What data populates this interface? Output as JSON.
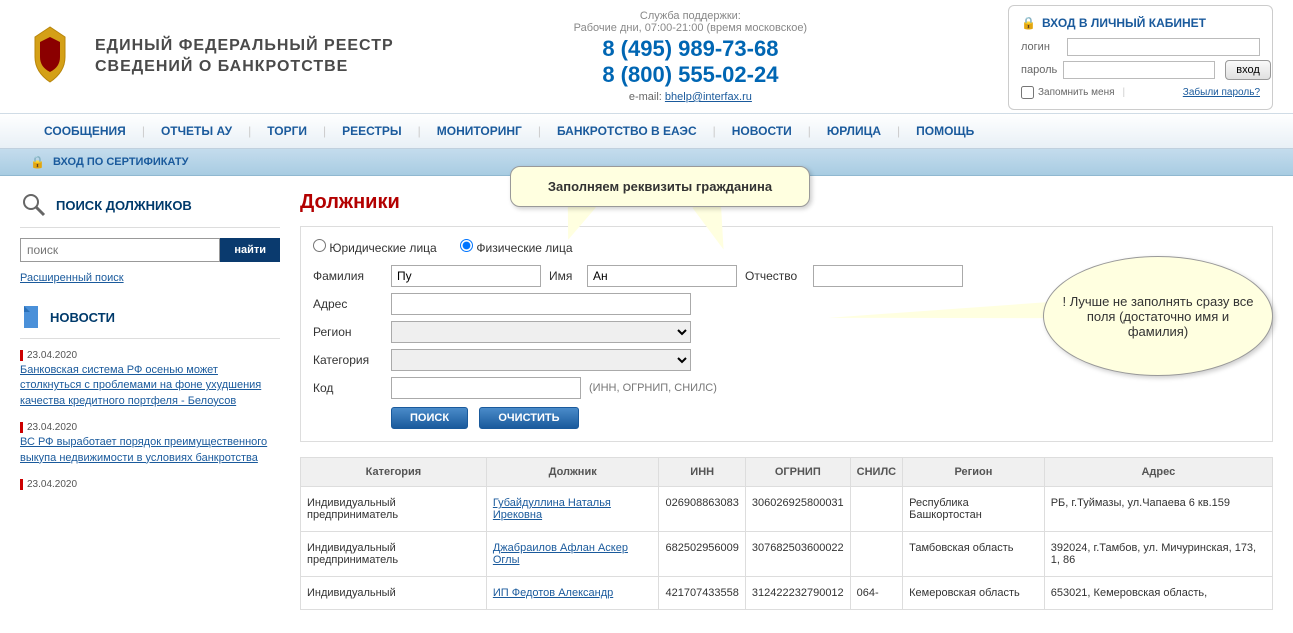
{
  "header": {
    "title_line1": "ЕДИНЫЙ  ФЕДЕРАЛЬНЫЙ  РЕЕСТР",
    "title_line2": "СВЕДЕНИЙ О БАНКРОТСТВЕ",
    "support_label": "Служба поддержки:",
    "support_hours": "Рабочие дни, 07:00-21:00 (время московское)",
    "phone1": "8 (495) 989-73-68",
    "phone2": "8 (800) 555-02-24",
    "email_prefix": "e-mail: ",
    "email": "bhelp@interfax.ru"
  },
  "login": {
    "title": "ВХОД В ЛИЧНЫЙ КАБИНЕТ",
    "login_label": "логин",
    "password_label": "пароль",
    "button": "вход",
    "remember": "Запомнить меня",
    "forgot": "Забыли пароль?"
  },
  "nav": [
    "СООБЩЕНИЯ",
    "ОТЧЕТЫ АУ",
    "ТОРГИ",
    "РЕЕСТРЫ",
    "МОНИТОРИНГ",
    "БАНКРОТСТВО В ЕАЭС",
    "НОВОСТИ",
    "ЮРЛИЦА",
    "ПОМОЩЬ"
  ],
  "cert_login": "ВХОД ПО СЕРТИФИКАТУ",
  "sidebar": {
    "search_title": "ПОИСК ДОЛЖНИКОВ",
    "search_placeholder": "поиск",
    "search_button": "найти",
    "advanced": "Расширенный поиск",
    "news_title": "НОВОСТИ",
    "news": [
      {
        "date": "23.04.2020",
        "title": "Банковская система РФ осенью может столкнуться с проблемами на фоне ухудшения качества кредитного портфеля - Белоусов"
      },
      {
        "date": "23.04.2020",
        "title": "ВС РФ выработает порядок преимущественного выкупа недвижимости в условиях банкротства"
      },
      {
        "date": "23.04.2020",
        "title": ""
      }
    ]
  },
  "content": {
    "page_title": "Должники",
    "callout1": "Заполняем реквизиты гражданина",
    "callout2": "! Лучше не заполнять сразу все поля (достаточно имя и фамилия)",
    "radio_legal": "Юридические лица",
    "radio_person": "Физические лица",
    "labels": {
      "lastname": "Фамилия",
      "firstname": "Имя",
      "middlename": "Отчество",
      "address": "Адрес",
      "region": "Регион",
      "category": "Категория",
      "code": "Код",
      "code_hint": "(ИНН, ОГРНИП, СНИЛС)"
    },
    "values": {
      "lastname": "Пу",
      "firstname": "Ан"
    },
    "buttons": {
      "search": "ПОИСК",
      "clear": "ОЧИСТИТЬ"
    }
  },
  "table": {
    "headers": [
      "Категория",
      "Должник",
      "ИНН",
      "ОГРНИП",
      "СНИЛС",
      "Регион",
      "Адрес"
    ],
    "rows": [
      {
        "category": "Индивидуальный предприниматель",
        "debtor": "Губайдуллина Наталья Ирековна",
        "inn": "026908863083",
        "ogrnip": "306026925800031",
        "snils": "",
        "region": "Республика Башкортостан",
        "address": "РБ, г.Туймазы, ул.Чапаева 6 кв.159"
      },
      {
        "category": "Индивидуальный предприниматель",
        "debtor": "Джабраилов Афлан Аскер Оглы",
        "inn": "682502956009",
        "ogrnip": "307682503600022",
        "snils": "",
        "region": "Тамбовская область",
        "address": "392024, г.Тамбов, ул. Мичуринская, 173, 1, 86"
      },
      {
        "category": "Индивидуальный",
        "debtor": "ИП Федотов Александр",
        "inn": "421707433558",
        "ogrnip": "312422232790012",
        "snils": "064-",
        "region": "Кемеровская область",
        "address": "653021, Кемеровская область,"
      }
    ]
  }
}
